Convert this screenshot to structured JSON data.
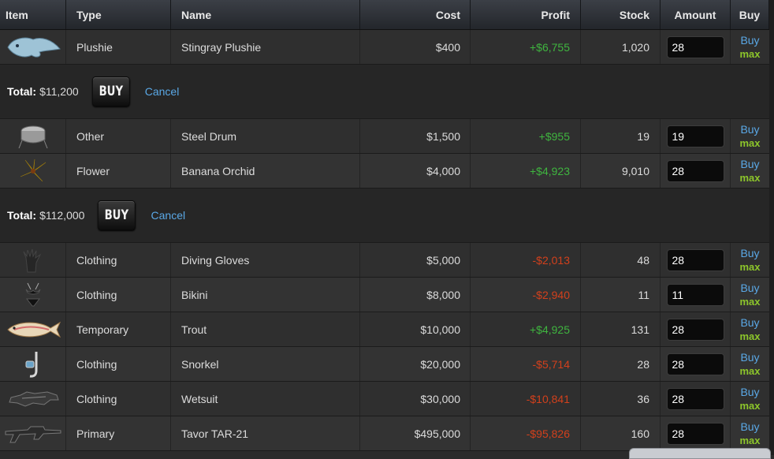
{
  "columns": {
    "item": "Item",
    "type": "Type",
    "name": "Name",
    "cost": "Cost",
    "profit": "Profit",
    "stock": "Stock",
    "amount": "Amount",
    "buy": "Buy"
  },
  "labels": {
    "buy_link": "Buy",
    "max_link": "max",
    "total_label": "Total:",
    "buy_button": "BUY",
    "cancel": "Cancel"
  },
  "rows": [
    {
      "icon": "stingray-plushie-icon",
      "type": "Plushie",
      "name": "Stingray Plushie",
      "cost": "$400",
      "profit": "+$6,755",
      "profit_sign": "pos",
      "stock": "1,020",
      "amount": "28"
    },
    {
      "icon": "steel-drum-icon",
      "type": "Other",
      "name": "Steel Drum",
      "cost": "$1,500",
      "profit": "+$955",
      "profit_sign": "pos",
      "stock": "19",
      "amount": "19"
    },
    {
      "icon": "banana-orchid-icon",
      "type": "Flower",
      "name": "Banana Orchid",
      "cost": "$4,000",
      "profit": "+$4,923",
      "profit_sign": "pos",
      "stock": "9,010",
      "amount": "28"
    },
    {
      "icon": "diving-gloves-icon",
      "type": "Clothing",
      "name": "Diving Gloves",
      "cost": "$5,000",
      "profit": "-$2,013",
      "profit_sign": "neg",
      "stock": "48",
      "amount": "28"
    },
    {
      "icon": "bikini-icon",
      "type": "Clothing",
      "name": "Bikini",
      "cost": "$8,000",
      "profit": "-$2,940",
      "profit_sign": "neg",
      "stock": "11",
      "amount": "11"
    },
    {
      "icon": "trout-icon",
      "type": "Temporary",
      "name": "Trout",
      "cost": "$10,000",
      "profit": "+$4,925",
      "profit_sign": "pos",
      "stock": "131",
      "amount": "28"
    },
    {
      "icon": "snorkel-icon",
      "type": "Clothing",
      "name": "Snorkel",
      "cost": "$20,000",
      "profit": "-$5,714",
      "profit_sign": "neg",
      "stock": "28",
      "amount": "28"
    },
    {
      "icon": "wetsuit-icon",
      "type": "Clothing",
      "name": "Wetsuit",
      "cost": "$30,000",
      "profit": "-$10,841",
      "profit_sign": "neg",
      "stock": "36",
      "amount": "28"
    },
    {
      "icon": "tavor-rifle-icon",
      "type": "Primary",
      "name": "Tavor TAR-21",
      "cost": "$495,000",
      "profit": "-$95,826",
      "profit_sign": "neg",
      "stock": "160",
      "amount": "28"
    }
  ],
  "confirmations": [
    {
      "total": "$11,200"
    },
    {
      "total": "$112,000"
    }
  ],
  "colors": {
    "profit_positive": "#3fb53f",
    "profit_negative": "#d2401c",
    "link": "#5aa8e6",
    "max": "#8dc62b"
  }
}
